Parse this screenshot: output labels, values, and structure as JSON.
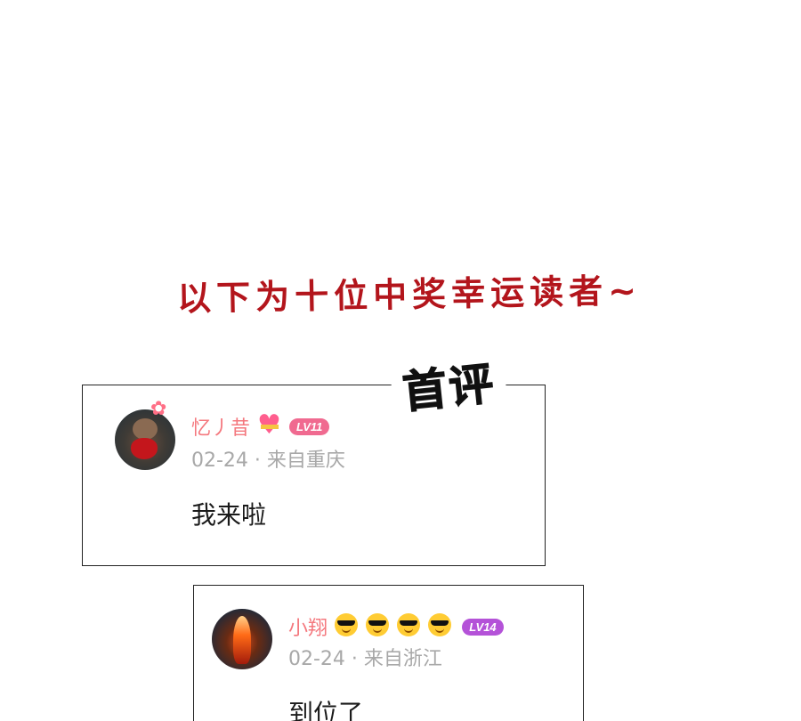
{
  "headline": "以下为十位中奖幸运读者~",
  "first_badge": "首评",
  "colors": {
    "headline": "#b3151c",
    "username": "#f4787e",
    "meta": "#a8a8a8",
    "badge_pink": "#f06a90",
    "badge_purple": "#b452d8"
  },
  "comments": [
    {
      "username": "忆丿昔",
      "name_icons": [
        "heart-gift-icon"
      ],
      "level": "LV11",
      "meta": "02-24 · 来自重庆",
      "text": "我来啦",
      "avatar_icon": "teddy-bear-avatar"
    },
    {
      "username": "小翔",
      "name_icons": [
        "sunglasses-face-icon",
        "sunglasses-face-icon",
        "sunglasses-face-icon",
        "sunglasses-face-icon"
      ],
      "level": "LV14",
      "meta": "02-24 · 来自浙江",
      "text": "到位了",
      "avatar_icon": "fire-figure-avatar"
    }
  ]
}
